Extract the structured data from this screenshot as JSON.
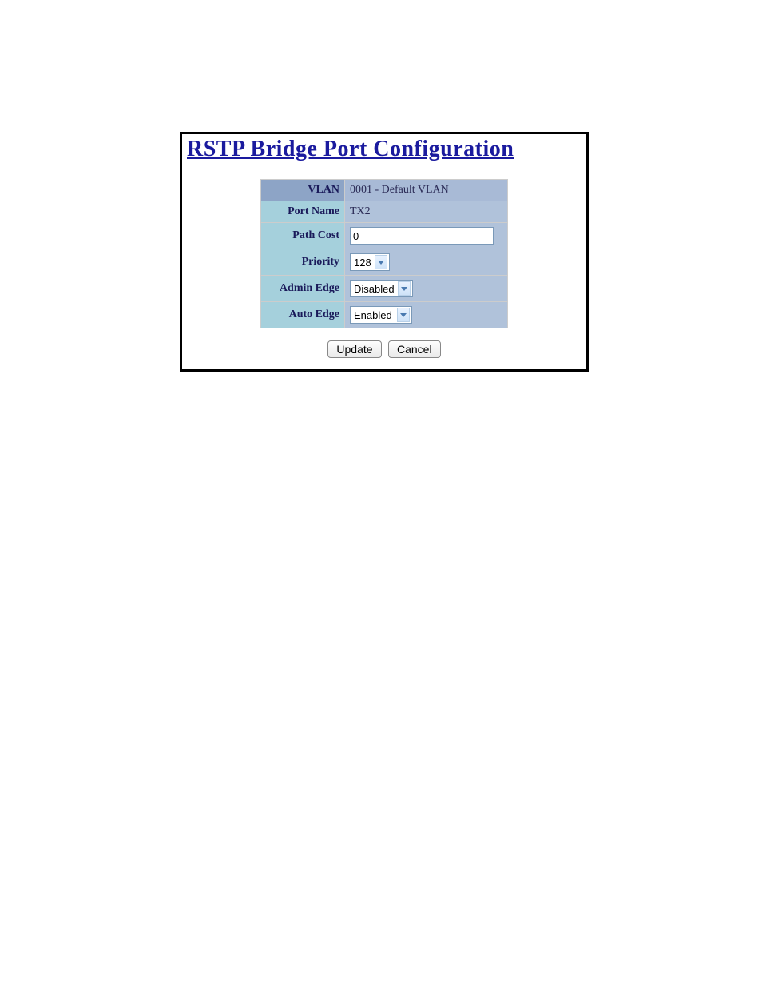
{
  "title": "RSTP Bridge Port Configuration",
  "fields": {
    "vlan_label": "VLAN",
    "vlan_value": "0001 - Default VLAN",
    "portname_label": "Port Name",
    "portname_value": "TX2",
    "pathcost_label": "Path Cost",
    "pathcost_value": "0",
    "priority_label": "Priority",
    "priority_value": "128",
    "adminedge_label": "Admin Edge",
    "adminedge_value": "Disabled",
    "autoedge_label": "Auto Edge",
    "autoedge_value": "Enabled"
  },
  "buttons": {
    "update": "Update",
    "cancel": "Cancel"
  }
}
